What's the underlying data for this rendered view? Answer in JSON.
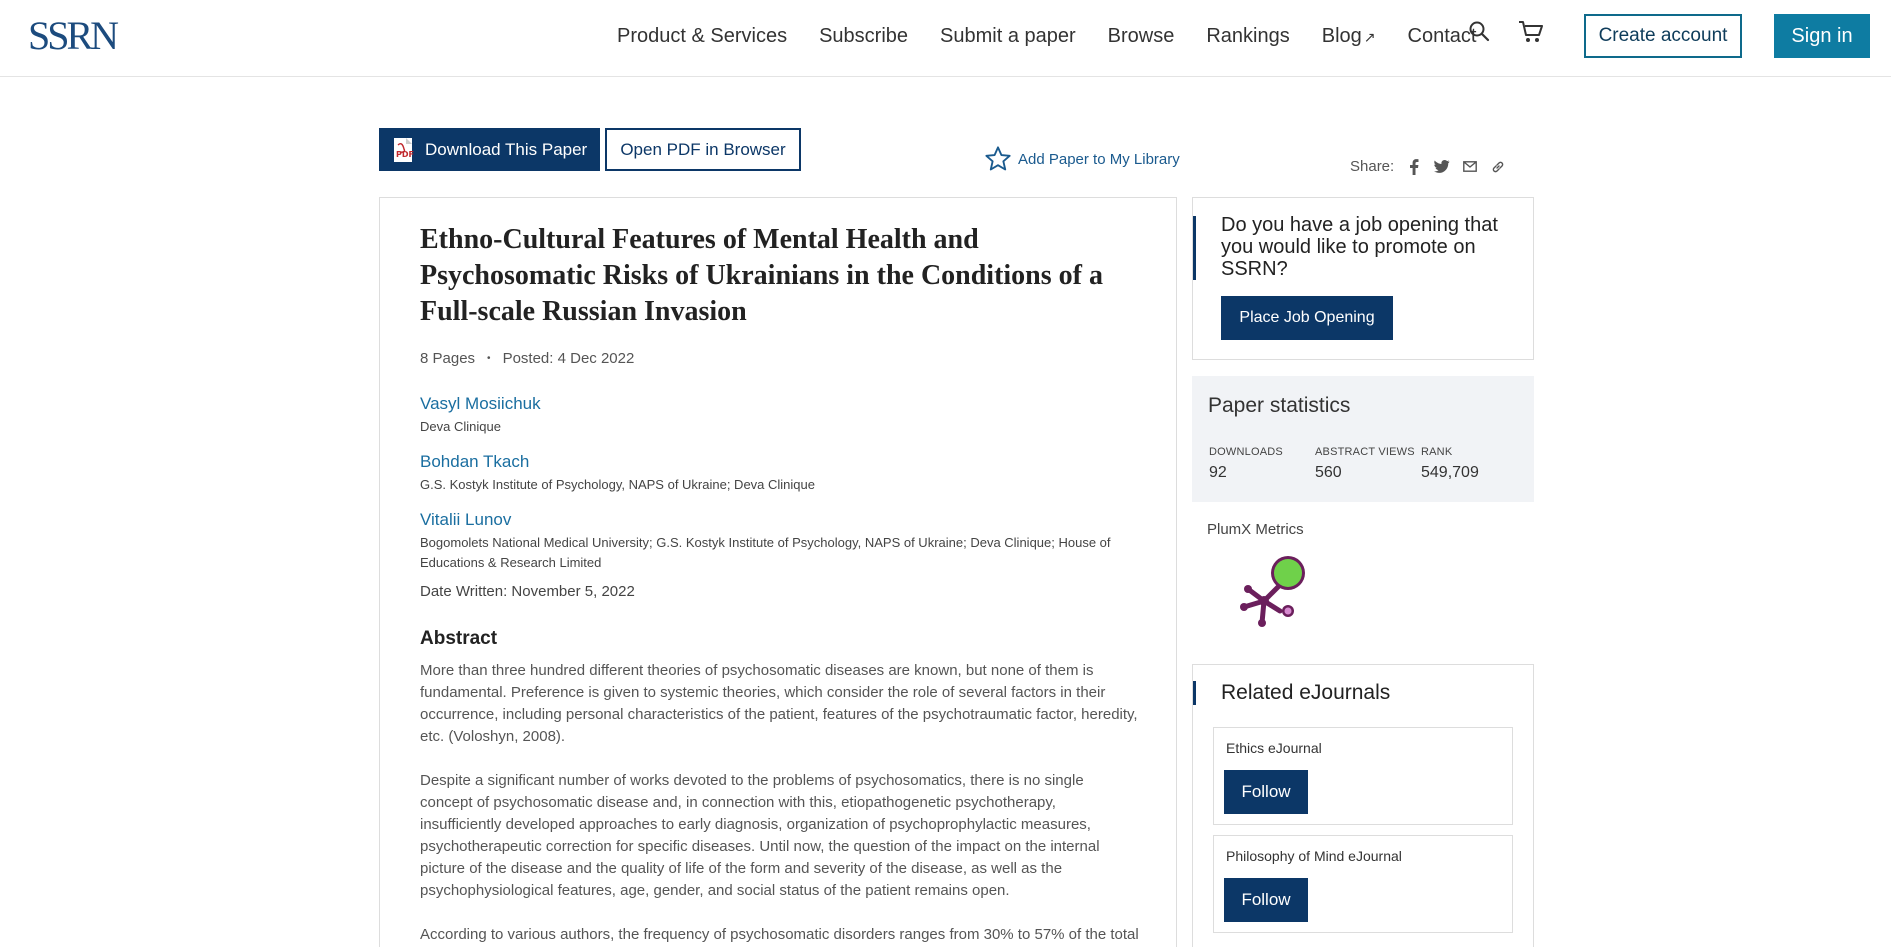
{
  "header": {
    "logo": "SSRN",
    "nav": [
      {
        "label": "Product & Services"
      },
      {
        "label": "Subscribe"
      },
      {
        "label": "Submit a paper"
      },
      {
        "label": "Browse"
      },
      {
        "label": "Rankings"
      },
      {
        "label": "Blog",
        "external": true
      },
      {
        "label": "Contact"
      }
    ],
    "create_account": "Create account",
    "sign_in": "Sign in"
  },
  "actions": {
    "download": "Download This Paper",
    "open_pdf": "Open PDF in Browser",
    "add_library": "Add Paper to My Library",
    "share_label": "Share:"
  },
  "paper": {
    "title": "Ethno-Cultural Features of Mental Health and Psychosomatic Risks of Ukrainians in the Conditions of a Full-scale Russian Invasion",
    "pages": "8 Pages",
    "posted": "Posted: 4 Dec 2022",
    "authors": [
      {
        "name": "Vasyl Mosiichuk",
        "affiliation": "Deva Clinique"
      },
      {
        "name": "Bohdan Tkach",
        "affiliation": "G.S. Kostyk Institute of Psychology, NAPS of Ukraine; Deva Clinique"
      },
      {
        "name": "Vitalii Lunov",
        "affiliation": "Bogomolets National Medical University; G.S. Kostyk Institute of Psychology, NAPS of Ukraine; Deva Clinique; House of Educations & Research Limited"
      }
    ],
    "date_written": "Date Written: November 5, 2022",
    "abstract_heading": "Abstract",
    "abstract": [
      "More than three hundred different theories of psychosomatic diseases are known, but none of them is fundamental. Preference is given to systemic theories, which consider the role of several factors in their occurrence, including personal characteristics of the patient, features of the psychotraumatic factor, heredity, etc. (Voloshyn, 2008).",
      "Despite a significant number of works devoted to the problems of psychosomatics, there is no single concept of psychosomatic disease and, in connection with this, etiopathogenetic psychotherapy, insufficiently developed approaches to early diagnosis, organization of psychoprophylactic measures, psychotherapeutic correction for specific diseases. Until now, the question of the impact on the internal picture of the disease and the quality of life of the form and severity of the disease, as well as the psychophysiological features, age, gender, and social status of the patient remains open.",
      "According to various authors, the frequency of psychosomatic disorders ranges from 30% to 57% of the total"
    ]
  },
  "job": {
    "text": "Do you have a job opening that you would like to promote on SSRN?",
    "button": "Place Job Opening"
  },
  "stats": {
    "title": "Paper statistics",
    "items": [
      {
        "label": "DOWNLOADS",
        "value": "92"
      },
      {
        "label": "ABSTRACT VIEWS",
        "value": "560"
      },
      {
        "label": "RANK",
        "value": "549,709"
      }
    ],
    "plumx": "PlumX Metrics"
  },
  "journals": {
    "title": "Related eJournals",
    "items": [
      {
        "name": "Ethics eJournal",
        "follow": "Follow"
      },
      {
        "name": "Philosophy of Mind eJournal",
        "follow": "Follow"
      }
    ]
  },
  "colors": {
    "navy": "#0c3767",
    "teal": "#0e7ca2",
    "link": "#1a6ea0",
    "plumx_purple": "#6b1f5c",
    "plumx_green": "#6fd14a"
  }
}
